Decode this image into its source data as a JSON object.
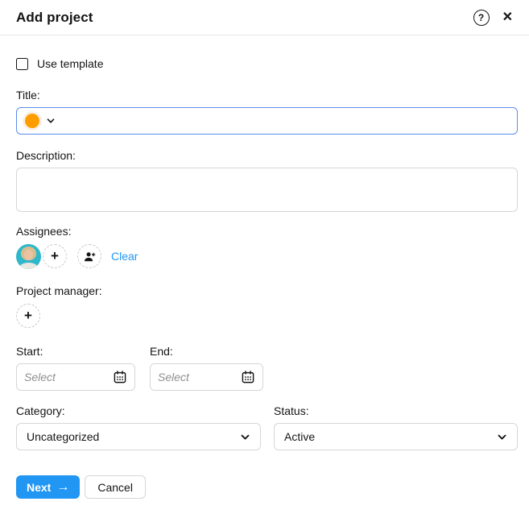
{
  "header": {
    "title": "Add project",
    "help_glyph": "?",
    "close_glyph": "✕"
  },
  "form": {
    "use_template_label": "Use template",
    "use_template_checked": false,
    "title_label": "Title:",
    "title_value": "",
    "description_label": "Description:",
    "description_value": "",
    "assignees_label": "Assignees:",
    "clear_label": "Clear",
    "project_manager_label": "Project manager:",
    "start_label": "Start:",
    "start_placeholder": "Select",
    "end_label": "End:",
    "end_placeholder": "Select",
    "category_label": "Category:",
    "category_value": "Uncategorized",
    "status_label": "Status:",
    "status_value": "Active"
  },
  "footer": {
    "next_label": "Next",
    "next_arrow": "→",
    "cancel_label": "Cancel"
  },
  "colors": {
    "accent_blue": "#2196f3",
    "focused_input_border": "#5b8def",
    "swatch_orange": "#ff9d00",
    "avatar_teal": "#2fb7cc"
  }
}
